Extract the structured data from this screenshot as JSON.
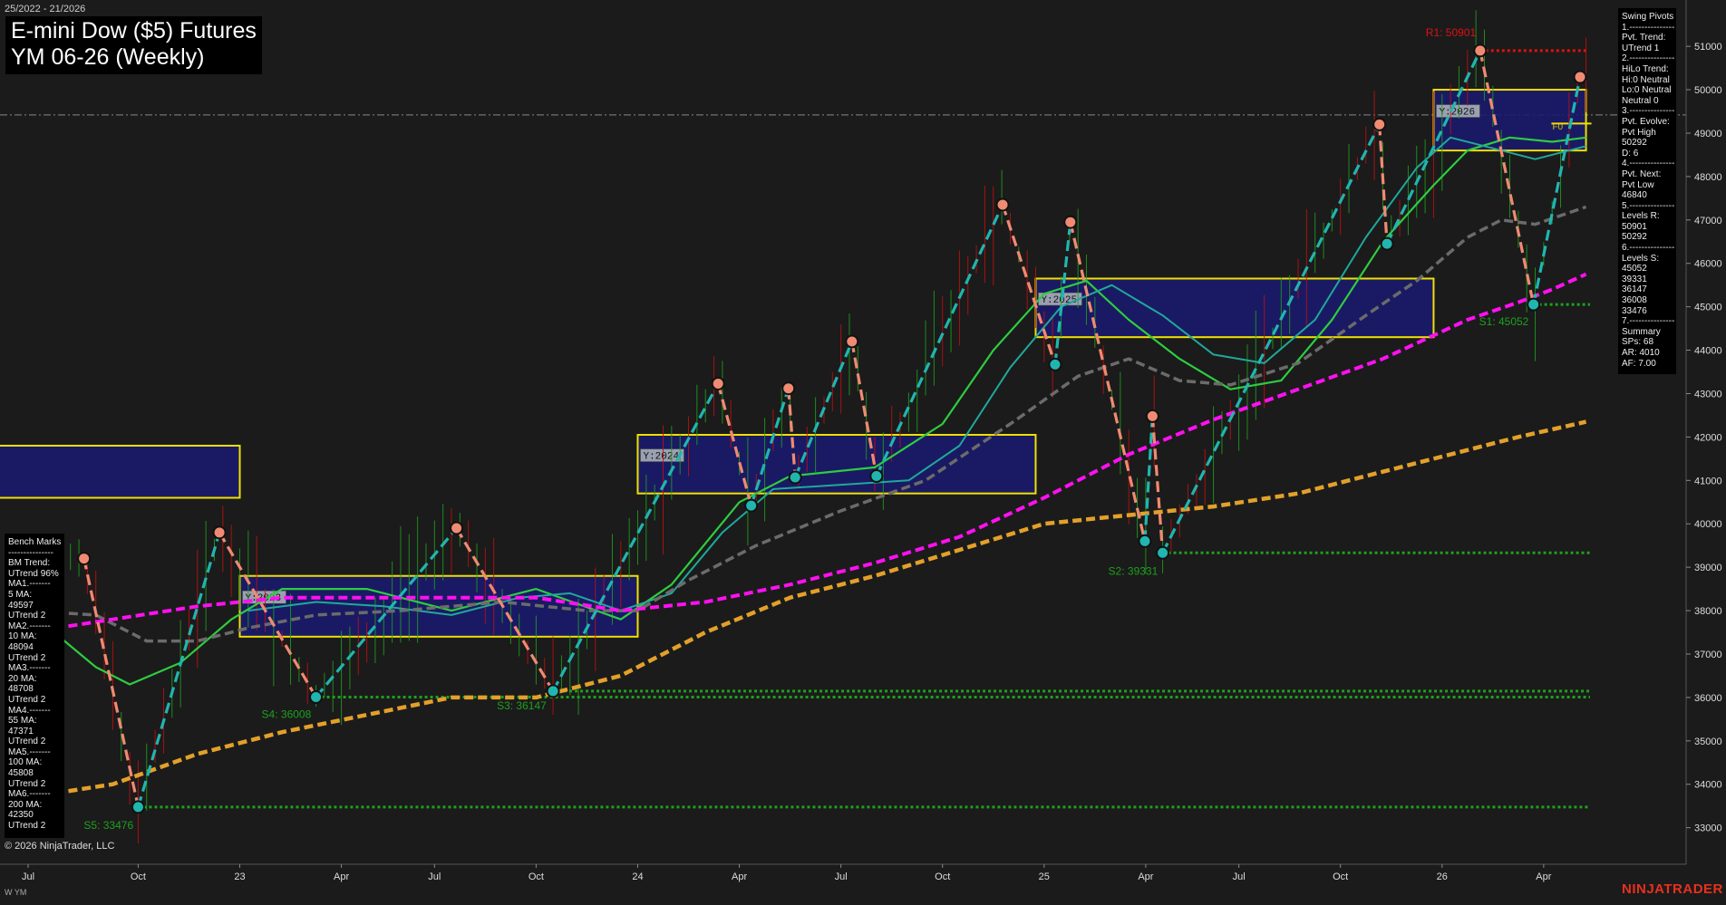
{
  "header": {
    "date_range": "25/2022 - 21/2026",
    "title_line1": "E-mini Dow ($5) Futures",
    "title_line2": "YM 06-26 (Weekly)"
  },
  "footer": {
    "copyright": "© 2026 NinjaTrader, LLC",
    "brand": "NINJATRADER",
    "instrument_code": "W YM"
  },
  "swing_pivots_panel": {
    "lines": [
      "Swing Pivots",
      "1.---------------",
      "Pvt. Trend:",
      "UTrend 1",
      "2.---------------",
      "HiLo Trend:",
      "Hi:0 Neutral",
      "Lo:0 Neutral",
      "Neutral 0",
      "3.---------------",
      "Pvt. Evolve:",
      "Pvt High",
      "50292",
      "D: 6",
      "4.---------------",
      "Pvt. Next:",
      "Pvt Low",
      "46840",
      "5.---------------",
      "Levels R:",
      "50901",
      "50292",
      "6.---------------",
      "Levels S:",
      "45052",
      "39331",
      "36147",
      "36008",
      "33476",
      "7.---------------",
      "Summary",
      "SPs: 68",
      "AR: 4010",
      "AF: 7.00"
    ]
  },
  "benchmarks_panel": {
    "lines": [
      "Bench Marks",
      "---------------",
      "BM Trend:",
      "UTrend 96%",
      "MA1.-------",
      "5 MA:",
      "49597",
      "UTrend 2",
      "MA2.-------",
      "10 MA:",
      "48094",
      "UTrend 2",
      "MA3.-------",
      "20 MA:",
      "48708",
      "UTrend 2",
      "MA4.-------",
      "55 MA:",
      "47371",
      "UTrend 2",
      "MA5.-------",
      "100 MA:",
      "45808",
      "UTrend 2",
      "MA6.-------",
      "200 MA:",
      "42350",
      "UTrend 2"
    ]
  },
  "colors": {
    "background": "#1b1b1b",
    "ma_green": "#2ecc40",
    "ma_teal": "#20a89a",
    "ma_gray": "#6b6b6b",
    "ma_magenta": "#ff10f0",
    "ma_orange": "#e3a02a",
    "swing_up": "#21b5b0",
    "swing_down": "#f08a72",
    "resistance": "#e01010",
    "support": "#1ea01e",
    "year_box_fill": "#1a1a6e",
    "year_box_border": "#f0e000",
    "candle_up": "#1ea01e",
    "candle_down": "#c01010"
  },
  "chart_data": {
    "type": "line",
    "timeframe": "Weekly",
    "ylim": [
      32200,
      51900
    ],
    "y_ticks": [
      33000,
      34000,
      35000,
      36000,
      37000,
      38000,
      39000,
      40000,
      41000,
      42000,
      43000,
      44000,
      45000,
      46000,
      47000,
      48000,
      49000,
      50000,
      51000
    ],
    "x_ticks": [
      {
        "label": "Jul",
        "t": 0
      },
      {
        "label": "Oct",
        "t": 13
      },
      {
        "label": "23",
        "t": 25
      },
      {
        "label": "Apr",
        "t": 37
      },
      {
        "label": "Jul",
        "t": 48
      },
      {
        "label": "Oct",
        "t": 60
      },
      {
        "label": "24",
        "t": 72
      },
      {
        "label": "Apr",
        "t": 84
      },
      {
        "label": "Jul",
        "t": 96
      },
      {
        "label": "Oct",
        "t": 108
      },
      {
        "label": "25",
        "t": 120
      },
      {
        "label": "Apr",
        "t": 132
      },
      {
        "label": "Jul",
        "t": 143
      },
      {
        "label": "Oct",
        "t": 155
      },
      {
        "label": "26",
        "t": 167
      },
      {
        "label": "Apr",
        "t": 179
      }
    ],
    "current_price": 49420,
    "swing_points": [
      {
        "t": 6.6,
        "v": 39200,
        "type": "high"
      },
      {
        "t": 13,
        "v": 33476,
        "type": "low"
      },
      {
        "t": 22.6,
        "v": 39800,
        "type": "high"
      },
      {
        "t": 34,
        "v": 36008,
        "type": "low"
      },
      {
        "t": 50.6,
        "v": 39900,
        "type": "high"
      },
      {
        "t": 62,
        "v": 36147,
        "type": "low"
      },
      {
        "t": 81.5,
        "v": 43230,
        "type": "high"
      },
      {
        "t": 85.4,
        "v": 40420,
        "type": "low"
      },
      {
        "t": 89.8,
        "v": 43120,
        "type": "high"
      },
      {
        "t": 90.6,
        "v": 41070,
        "type": "low"
      },
      {
        "t": 97.3,
        "v": 44200,
        "type": "high"
      },
      {
        "t": 100.2,
        "v": 41100,
        "type": "low"
      },
      {
        "t": 115.1,
        "v": 47350,
        "type": "high"
      },
      {
        "t": 121.3,
        "v": 43670,
        "type": "low"
      },
      {
        "t": 123.1,
        "v": 46950,
        "type": "high"
      },
      {
        "t": 131.9,
        "v": 39600,
        "type": "low"
      },
      {
        "t": 132.8,
        "v": 42480,
        "type": "high"
      },
      {
        "t": 134,
        "v": 39331,
        "type": "low"
      },
      {
        "t": 159.6,
        "v": 49200,
        "type": "high"
      },
      {
        "t": 160.5,
        "v": 46450,
        "type": "low"
      },
      {
        "t": 171.5,
        "v": 50901,
        "type": "high"
      },
      {
        "t": 177.8,
        "v": 45052,
        "type": "low"
      },
      {
        "t": 183.3,
        "v": 50292,
        "type": "high"
      }
    ],
    "levels": [
      {
        "label": "R1: 50901",
        "value": 50901,
        "kind": "resistance",
        "t_start": 171.5
      },
      {
        "label": "S1: 45052",
        "value": 45052,
        "kind": "support",
        "t_start": 177.8
      },
      {
        "label": "S2: 39331",
        "value": 39331,
        "kind": "support",
        "t_start": 134
      },
      {
        "label": "S3: 36147",
        "value": 36147,
        "kind": "support",
        "t_start": 62
      },
      {
        "label": "S4: 36008",
        "value": 36008,
        "kind": "support",
        "t_start": 34
      },
      {
        "label": "S5: 33476",
        "value": 33476,
        "kind": "support",
        "t_start": 13
      }
    ],
    "year_boxes": [
      {
        "label": "",
        "t0": -25,
        "t1": 25,
        "v0": 40600,
        "v1": 41800
      },
      {
        "label": "Y:2023",
        "t0": 25,
        "t1": 72,
        "v0": 37400,
        "v1": 38800
      },
      {
        "label": "Y:2024",
        "t0": 72,
        "t1": 119,
        "v0": 40700,
        "v1": 42050
      },
      {
        "label": "Y:2025",
        "t0": 119,
        "t1": 166,
        "v0": 44300,
        "v1": 45650
      },
      {
        "label": "Y:2026",
        "t0": 166,
        "t1": 184,
        "v0": 48600,
        "v1": 50000
      }
    ],
    "fib_label": "F0",
    "series": [
      {
        "id": "ma_green",
        "color": "#2ecc40",
        "dash": "",
        "width": 2.2,
        "points": [
          [
            0,
            38000
          ],
          [
            8,
            36700
          ],
          [
            12,
            36300
          ],
          [
            18,
            36800
          ],
          [
            24,
            37800
          ],
          [
            30,
            38500
          ],
          [
            40,
            38500
          ],
          [
            50,
            38000
          ],
          [
            60,
            38500
          ],
          [
            70,
            37800
          ],
          [
            76,
            38600
          ],
          [
            84,
            40500
          ],
          [
            90,
            41100
          ],
          [
            100,
            41300
          ],
          [
            108,
            42300
          ],
          [
            114,
            44000
          ],
          [
            120,
            45300
          ],
          [
            125,
            45600
          ],
          [
            130,
            44700
          ],
          [
            136,
            43800
          ],
          [
            142,
            43100
          ],
          [
            148,
            43300
          ],
          [
            154,
            44700
          ],
          [
            160,
            46500
          ],
          [
            166,
            47800
          ],
          [
            170,
            48600
          ],
          [
            175,
            48900
          ],
          [
            180,
            48800
          ],
          [
            184,
            48900
          ]
        ]
      },
      {
        "id": "ma_teal",
        "color": "#20a89a",
        "dash": "",
        "width": 2.0,
        "points": [
          [
            26,
            38000
          ],
          [
            34,
            38200
          ],
          [
            42,
            38100
          ],
          [
            50,
            37900
          ],
          [
            58,
            38300
          ],
          [
            64,
            38400
          ],
          [
            70,
            38000
          ],
          [
            76,
            38400
          ],
          [
            82,
            39800
          ],
          [
            88,
            40800
          ],
          [
            96,
            40900
          ],
          [
            104,
            41000
          ],
          [
            110,
            41800
          ],
          [
            116,
            43600
          ],
          [
            122,
            45000
          ],
          [
            128,
            45500
          ],
          [
            134,
            44800
          ],
          [
            140,
            43900
          ],
          [
            146,
            43700
          ],
          [
            152,
            44700
          ],
          [
            158,
            46600
          ],
          [
            164,
            48200
          ],
          [
            168,
            48900
          ],
          [
            172,
            48700
          ],
          [
            178,
            48400
          ],
          [
            184,
            48700
          ]
        ]
      },
      {
        "id": "ma_gray",
        "color": "#6b6b6b",
        "dash": "10,5",
        "width": 3.5,
        "points": [
          [
            0,
            38000
          ],
          [
            8,
            37900
          ],
          [
            14,
            37300
          ],
          [
            20,
            37300
          ],
          [
            26,
            37600
          ],
          [
            34,
            37900
          ],
          [
            44,
            38000
          ],
          [
            56,
            38200
          ],
          [
            66,
            38000
          ],
          [
            72,
            38000
          ],
          [
            78,
            38700
          ],
          [
            86,
            39500
          ],
          [
            96,
            40300
          ],
          [
            106,
            41000
          ],
          [
            116,
            42300
          ],
          [
            124,
            43400
          ],
          [
            130,
            43800
          ],
          [
            136,
            43300
          ],
          [
            142,
            43200
          ],
          [
            150,
            43700
          ],
          [
            158,
            44800
          ],
          [
            164,
            45600
          ],
          [
            170,
            46600
          ],
          [
            174,
            47000
          ],
          [
            178,
            46900
          ],
          [
            184,
            47300
          ]
        ]
      },
      {
        "id": "ma_magenta",
        "color": "#ff10f0",
        "dash": "10,5",
        "width": 4.0,
        "points": [
          [
            0,
            37500
          ],
          [
            10,
            37800
          ],
          [
            20,
            38100
          ],
          [
            30,
            38300
          ],
          [
            40,
            38300
          ],
          [
            50,
            38300
          ],
          [
            60,
            38300
          ],
          [
            70,
            38000
          ],
          [
            80,
            38200
          ],
          [
            90,
            38600
          ],
          [
            100,
            39100
          ],
          [
            110,
            39700
          ],
          [
            120,
            40600
          ],
          [
            130,
            41600
          ],
          [
            140,
            42400
          ],
          [
            150,
            43100
          ],
          [
            160,
            43800
          ],
          [
            170,
            44700
          ],
          [
            176,
            45100
          ],
          [
            180,
            45400
          ],
          [
            184,
            45750
          ]
        ]
      },
      {
        "id": "ma_orange",
        "color": "#e3a02a",
        "dash": "10,5",
        "width": 4.5,
        "points": [
          [
            0,
            33700
          ],
          [
            10,
            34000
          ],
          [
            20,
            34700
          ],
          [
            30,
            35200
          ],
          [
            40,
            35600
          ],
          [
            50,
            36000
          ],
          [
            60,
            36000
          ],
          [
            70,
            36500
          ],
          [
            80,
            37500
          ],
          [
            90,
            38300
          ],
          [
            100,
            38800
          ],
          [
            110,
            39400
          ],
          [
            120,
            40000
          ],
          [
            130,
            40200
          ],
          [
            140,
            40400
          ],
          [
            150,
            40700
          ],
          [
            160,
            41200
          ],
          [
            170,
            41700
          ],
          [
            176,
            42000
          ],
          [
            184,
            42350
          ]
        ]
      }
    ]
  }
}
